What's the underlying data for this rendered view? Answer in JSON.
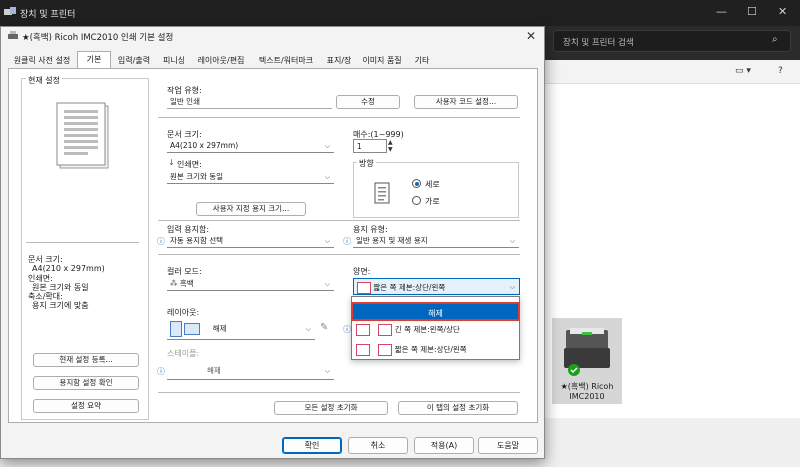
{
  "background_window": {
    "title": "장치 및 프린터",
    "search_placeholder": "장치 및 프린터 검색",
    "printer_label": "★(흑백) Ricoh IMC2010"
  },
  "dialog": {
    "title": "★(흑백) Ricoh IMC2010 인쇄 기본 설정",
    "tabs": [
      "원클릭 사전 설정",
      "기본",
      "입력/출력",
      "피니싱",
      "레이아웃/편집",
      "텍스트/워터마크",
      "표지/장",
      "이미지 품질",
      "기타"
    ],
    "active_tab": "기본",
    "current_settings": {
      "heading": "현재 설정",
      "summary_lines": [
        "문서 크기:",
        "A4(210 x 297mm)",
        "인쇄면:",
        "원본 크기와 동일",
        "축소/확대:",
        "용지 크기에 맞춤"
      ],
      "register_button": "현재 설정 등록...",
      "paper_check_button": "용지함 설정 확인",
      "summary_button": "설정 요약"
    },
    "job_type": {
      "label": "작업 유형:",
      "value": "일반 인쇄",
      "edit_button": "수정",
      "user_code_button": "사용자 코드 설정..."
    },
    "document_size": {
      "label": "문서 크기:",
      "value": "A4(210 x 297mm)"
    },
    "copies": {
      "label": "매수:(1~999)",
      "value": "1"
    },
    "print_side": {
      "label": "인쇄면:",
      "value": "원본 크기와 동일"
    },
    "orientation": {
      "label": "방향",
      "portrait": "세로",
      "landscape": "가로",
      "selected": "세로"
    },
    "custom_size_button": "사용자 지정 용지 크기...",
    "input_tray": {
      "label": "입력 용지함:",
      "value": "자동 용지함 선택"
    },
    "paper_type": {
      "label": "용지 유형:",
      "value": "일반 용지 및 재생 용지"
    },
    "color_mode": {
      "label": "컬러 모드:",
      "value": "흑백"
    },
    "duplex": {
      "label": "양면:",
      "value": "짧은 쪽 제본:상단/왼쪽",
      "options": [
        "해제",
        "긴 쪽 제본:왼쪽/상단",
        "짧은 쪽 제본:상단/왼쪽"
      ],
      "highlighted": "해제"
    },
    "layout": {
      "label": "레이아웃:",
      "value": "해제"
    },
    "staple": {
      "label": "스테이플:",
      "value": "해제"
    },
    "reset_all_button": "모든 설정 초기화",
    "reset_tab_button": "이 탭의 설정 초기화",
    "buttons": {
      "ok": "확인",
      "cancel": "취소",
      "apply": "적용(A)",
      "help": "도움말"
    }
  },
  "colors": {
    "accent": "#0067c0",
    "highlight_border": "#e03c31",
    "info": "#1e5fbf"
  }
}
